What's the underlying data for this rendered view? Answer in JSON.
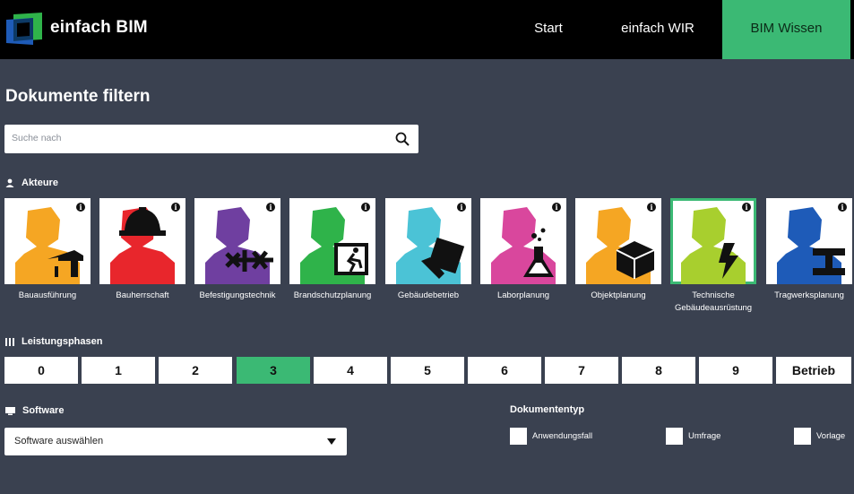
{
  "header": {
    "brand": "einfach BIM",
    "nav": [
      {
        "label": "Start"
      },
      {
        "label": "einfach WIR"
      },
      {
        "label": "BIM Wissen"
      }
    ],
    "accent": "#3bb974"
  },
  "page": {
    "title": "Dokumente filtern"
  },
  "search": {
    "placeholder": "Suche nach",
    "icon": "search-icon"
  },
  "akteure": {
    "heading": "Akteure",
    "icon": "person-icon",
    "items": [
      {
        "label": "Bauausführung",
        "color": "#f5a623",
        "icon": "crane-icon"
      },
      {
        "label": "Bauherrschaft",
        "color": "#e8262c",
        "icon": "hardhat-icon"
      },
      {
        "label": "Befestigungstechnik",
        "color": "#6f3fa0",
        "icon": "fastener-icon"
      },
      {
        "label": "Brandschutzplanung",
        "color": "#2fb34a",
        "icon": "emergency-exit-icon"
      },
      {
        "label": "Gebäudebetrieb",
        "color": "#4bc3d6",
        "icon": "tools-icon"
      },
      {
        "label": "Laborplanung",
        "color": "#d9479d",
        "icon": "flask-icon"
      },
      {
        "label": "Objektplanung",
        "color": "#f5a623",
        "icon": "cube-icon"
      },
      {
        "label": "Technische Gebäudeausrüstung",
        "color": "#a8cf2e",
        "icon": "lightning-icon",
        "selected": true
      },
      {
        "label": "Tragwerksplanung",
        "color": "#1e5bb8",
        "icon": "beam-icon"
      }
    ]
  },
  "leistungsphasen": {
    "heading": "Leistungsphasen",
    "icon": "bars-icon",
    "items": [
      "0",
      "1",
      "2",
      "3",
      "4",
      "5",
      "6",
      "7",
      "8",
      "9",
      "Betrieb"
    ],
    "active": "3"
  },
  "software": {
    "heading": "Software",
    "icon": "monitor-icon",
    "select_value": "Software auswählen"
  },
  "dokumententyp": {
    "heading": "Dokumententyp",
    "options": [
      "Anwendungsfall",
      "Umfrage",
      "Vorlage"
    ]
  }
}
